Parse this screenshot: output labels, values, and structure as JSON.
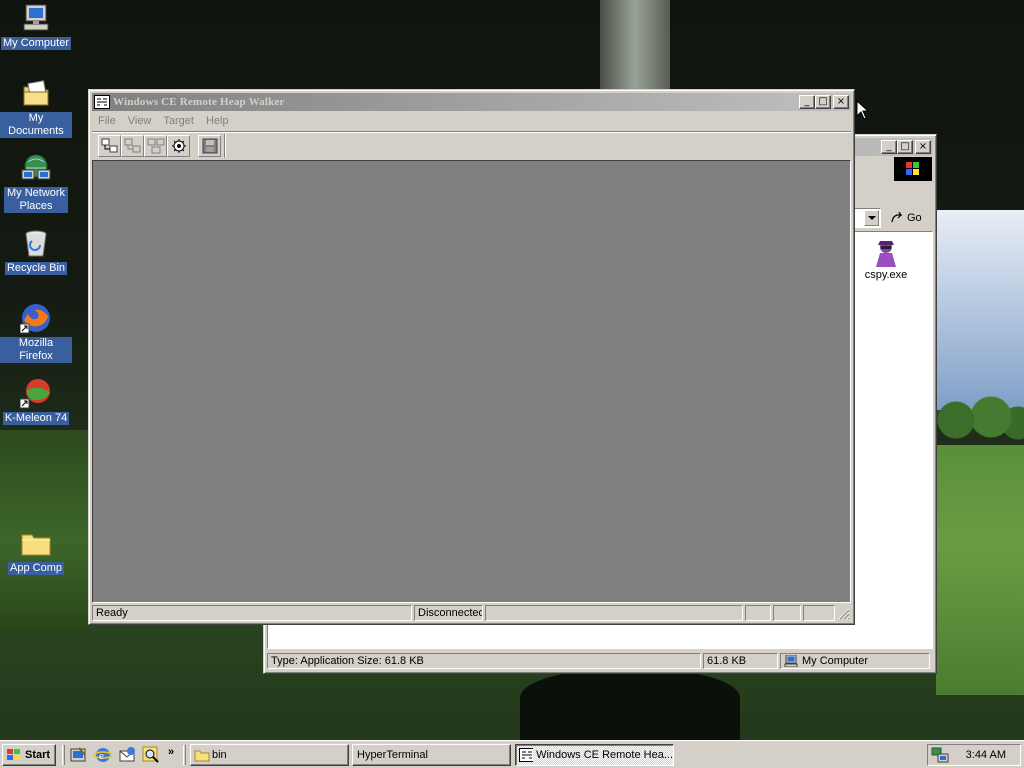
{
  "desktop_icons": [
    {
      "label": "My Computer",
      "icon": "my-computer-icon"
    },
    {
      "label": "My Documents",
      "icon": "my-documents-icon"
    },
    {
      "label": "My Network Places",
      "icon": "network-places-icon"
    },
    {
      "label": "Recycle Bin",
      "icon": "recycle-bin-icon"
    },
    {
      "label": "Mozilla Firefox",
      "icon": "firefox-icon"
    },
    {
      "label": "K-Meleon 74",
      "icon": "kmeleon-icon"
    },
    {
      "label": "App Comp",
      "icon": "folder-icon"
    }
  ],
  "heap_window": {
    "title": "Windows CE Remote Heap Walker",
    "menu": [
      "File",
      "View",
      "Target",
      "Help"
    ],
    "toolbar_icons": [
      "connect-icon",
      "refresh-icon",
      "heap-list-icon",
      "settings-icon",
      "save-icon"
    ],
    "status": {
      "left": "Ready",
      "connection": "Disconnected"
    }
  },
  "explorer_window": {
    "go_label": "Go",
    "file_label": "cspy.exe",
    "status": {
      "info": "Type: Application Size: 61.8 KB",
      "size": "61.8 KB",
      "zone": "My Computer"
    }
  },
  "taskbar": {
    "start_label": "Start",
    "tasks": [
      {
        "label": "bin",
        "icon": "folder-icon",
        "active": false
      },
      {
        "label": "HyperTerminal",
        "icon": "",
        "active": false
      },
      {
        "label": "Windows CE Remote Hea...",
        "icon": "heap-walker-icon",
        "active": true
      }
    ],
    "clock": "3:44 AM"
  },
  "colors": {
    "desktop_label_bg": "#3a5f9e",
    "window_face": "#d4d0c8",
    "client_gray": "#808080",
    "inactive_title_start": "#808080",
    "inactive_title_end": "#c0c0c0"
  }
}
